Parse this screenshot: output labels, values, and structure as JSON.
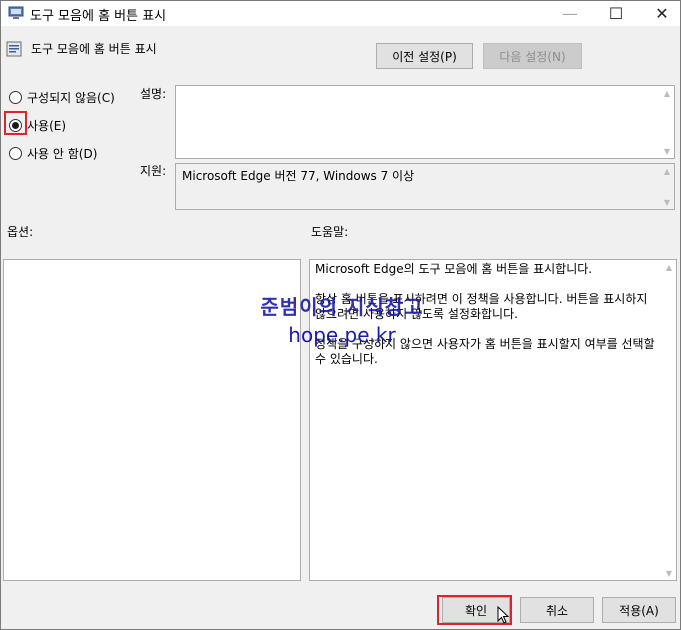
{
  "window": {
    "title": "도구 모음에 홈 버튼 표시",
    "controls": {
      "minimize": "—",
      "maximize": "☐",
      "close": "✕"
    }
  },
  "policy": {
    "title": "도구 모음에 홈 버튼 표시"
  },
  "nav": {
    "prev_label": "이전 설정(P)",
    "next_label": "다음 설정(N)"
  },
  "options": [
    {
      "label": "구성되지 않음(C)",
      "selected": false
    },
    {
      "label": "사용(E)",
      "selected": true
    },
    {
      "label": "사용 안 함(D)",
      "selected": false
    }
  ],
  "description": {
    "label": "설명:",
    "value": ""
  },
  "supported": {
    "label": "지원:",
    "value": "Microsoft Edge 버전 77, Windows 7 이상"
  },
  "options_panel": {
    "label": "옵션:"
  },
  "help": {
    "label": "도움말:",
    "paragraphs": [
      "Microsoft Edge의 도구 모음에 홈 버튼을 표시합니다.",
      "항상 홈 버튼을 표시하려면 이 정책을 사용합니다. 버튼을 표시하지 않으려면 사용하지 않도록 설정화합니다.",
      "정책을 구성하지 않으면 사용자가 홈 버튼을 표시할지 여부를 선택할 수 있습니다."
    ]
  },
  "watermark": {
    "line1": "준범이의 지식창고",
    "line2": "hope.pe.kr"
  },
  "footer": {
    "ok_label": "확인",
    "cancel_label": "취소",
    "apply_label": "적용(A)"
  },
  "colors": {
    "highlight": "#d9262c",
    "watermark": "#1a1aa8"
  }
}
